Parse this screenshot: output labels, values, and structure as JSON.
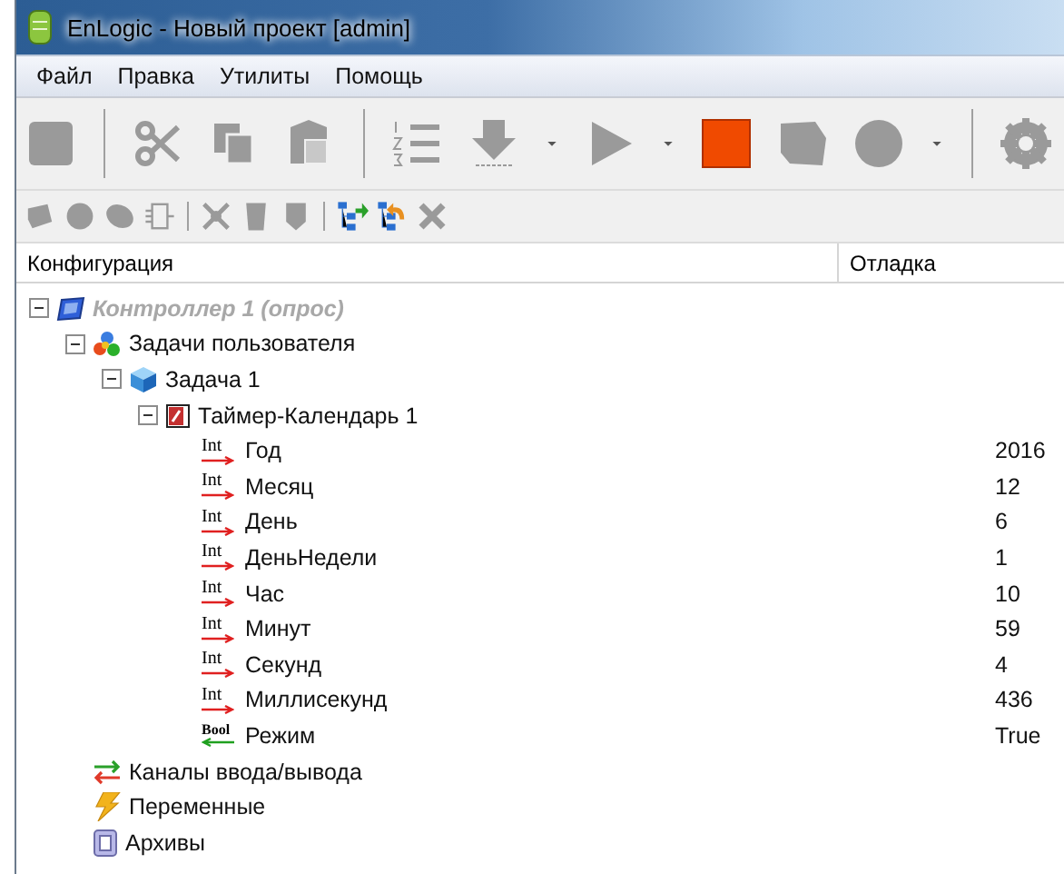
{
  "window": {
    "title": "EnLogic - Новый проект [admin]"
  },
  "menu": [
    "Файл",
    "Правка",
    "Утилиты",
    "Помощь"
  ],
  "columns": [
    "Конфигурация",
    "Отладка"
  ],
  "tree": [
    {
      "kind": "controller",
      "label": "Контроллер 1 (опрос)",
      "disabled": true,
      "expanded": true,
      "children": [
        {
          "kind": "tasks",
          "label": "Задачи пользователя",
          "disabled": false,
          "expanded": true,
          "children": [
            {
              "kind": "task",
              "label": "Задача 1",
              "disabled": false,
              "expanded": true,
              "children": [
                {
                  "kind": "timer",
                  "label": "Таймер-Календарь 1",
                  "disabled": false,
                  "expanded": true,
                  "children": [
                    {
                      "kind": "output",
                      "type": "Int",
                      "label": "Год",
                      "value": "2016"
                    },
                    {
                      "kind": "output",
                      "type": "Int",
                      "label": "Месяц",
                      "value": "12"
                    },
                    {
                      "kind": "output",
                      "type": "Int",
                      "label": "День",
                      "value": "6"
                    },
                    {
                      "kind": "output",
                      "type": "Int",
                      "label": "ДеньНедели",
                      "value": "1"
                    },
                    {
                      "kind": "output",
                      "type": "Int",
                      "label": "Час",
                      "value": "10"
                    },
                    {
                      "kind": "output",
                      "type": "Int",
                      "label": "Минут",
                      "value": "59"
                    },
                    {
                      "kind": "output",
                      "type": "Int",
                      "label": "Секунд",
                      "value": "4"
                    },
                    {
                      "kind": "output",
                      "type": "Int",
                      "label": "Миллисекунд",
                      "value": "436"
                    },
                    {
                      "kind": "input",
                      "type": "Bool",
                      "label": "Режим",
                      "value": "True"
                    }
                  ]
                }
              ]
            }
          ]
        },
        {
          "kind": "io",
          "label": "Каналы ввода/вывода",
          "disabled": false
        },
        {
          "kind": "variables",
          "label": "Переменные",
          "disabled": false
        },
        {
          "kind": "archive",
          "label": "Архивы",
          "disabled": false
        }
      ]
    }
  ]
}
